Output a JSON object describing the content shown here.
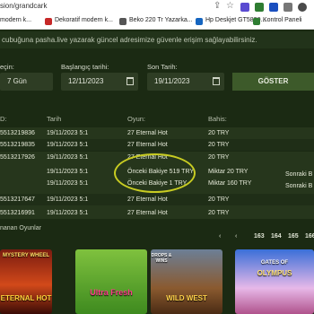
{
  "browser": {
    "url": "sion/grandcark",
    "bookmarks": [
      "modern k...",
      "Dekoratif modern k...",
      "Beko 220 Tr Yazarka...",
      "Hp Deskjet GT5820...",
      "Kontrol Paneli"
    ]
  },
  "notice": "cubuğuna pasha.live yazarak güncel adresimize güvenle erişim sağlayabilirsiniz.",
  "filters": {
    "period_label": "eçin:",
    "period_value": "7 Gün",
    "start_label": "Başlangıç tarihi:",
    "start_value": "12/11/2023",
    "end_label": "Son Tarih:",
    "end_value": "19/11/2023",
    "submit_label": "GÖSTER"
  },
  "table": {
    "headers": [
      "D:",
      "Tarih",
      "Oyun:",
      "Bahis:"
    ],
    "rows": [
      {
        "id": "5513219836",
        "date": "19/11/2023 5:1",
        "game": "27 Eternal Hot",
        "bet": "20 TRY"
      },
      {
        "id": "5513219835",
        "date": "19/11/2023 5:1",
        "game": "27 Eternal Hot",
        "bet": "20 TRY"
      },
      {
        "id": "5513217926",
        "date": "19/11/2023 5:1",
        "game": "27 Eternal Hot",
        "bet": "20 TRY"
      },
      {
        "id": "",
        "date": "19/11/2023 5:1",
        "game": "Önceki Bakiye 519 TRY",
        "bet": "Miktar 20 TRY",
        "extra": "Sonraki B"
      },
      {
        "id": "",
        "date": "19/11/2023 5:1",
        "game": "Önceki Bakiye 1 TRY",
        "bet": "Miktar 160 TRY",
        "extra": "Sonraki B"
      },
      {
        "id": "5513217647",
        "date": "19/11/2023 5:1",
        "game": "27 Eternal Hot",
        "bet": "20 TRY"
      },
      {
        "id": "5513216991",
        "date": "19/11/2023 5:1",
        "game": "27 Eternal Hot",
        "bet": "20 TRY"
      }
    ]
  },
  "footer_title": "nanan Oyunlar",
  "pagination": [
    "‹",
    "163",
    "164",
    "165",
    "166"
  ],
  "games": [
    {
      "title": "ETERNAL HOT",
      "top": "MYSTERY WHEEL"
    },
    {
      "title": "Ultra Fresh",
      "top": ""
    },
    {
      "title": "WILD WEST",
      "top": "DROPS & WINS"
    },
    {
      "title": "OLYMPUS",
      "top": "GATES OF"
    }
  ],
  "colors": {
    "accent": "#3d5a2a",
    "highlight": "#c8cc22",
    "background": "#1b2a13"
  }
}
